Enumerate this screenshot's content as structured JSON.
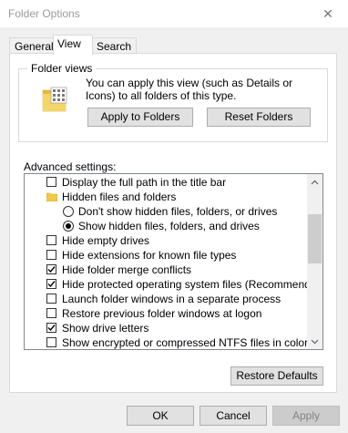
{
  "window": {
    "title": "Folder Options",
    "close_glyph": "✕"
  },
  "tabs": [
    {
      "label": "General",
      "active": false
    },
    {
      "label": "View",
      "active": true
    },
    {
      "label": "Search",
      "active": false
    }
  ],
  "folder_views": {
    "legend": "Folder views",
    "description": "You can apply this view (such as Details or Icons) to all folders of this type.",
    "icon": "folder-views-icon",
    "apply_button": "Apply to Folders",
    "reset_button": "Reset Folders"
  },
  "advanced": {
    "label": "Advanced settings:",
    "items": [
      {
        "label": "Display the full path in the title bar",
        "control": "checkbox",
        "checked": false
      },
      {
        "label": "Hidden files and folders",
        "control": "folder-icon"
      },
      {
        "label": "Don't show hidden files, folders, or drives",
        "control": "radio",
        "checked": false
      },
      {
        "label": "Show hidden files, folders, and drives",
        "control": "radio",
        "checked": true
      },
      {
        "label": "Hide empty drives",
        "control": "checkbox",
        "checked": false
      },
      {
        "label": "Hide extensions for known file types",
        "control": "checkbox",
        "checked": false
      },
      {
        "label": "Hide folder merge conflicts",
        "control": "checkbox",
        "checked": true
      },
      {
        "label": "Hide protected operating system files (Recommended)",
        "control": "checkbox",
        "checked": true
      },
      {
        "label": "Launch folder windows in a separate process",
        "control": "checkbox",
        "checked": false
      },
      {
        "label": "Restore previous folder windows at logon",
        "control": "checkbox",
        "checked": false
      },
      {
        "label": "Show drive letters",
        "control": "checkbox",
        "checked": true
      },
      {
        "label": "Show encrypted or compressed NTFS files in color",
        "control": "checkbox",
        "checked": false
      }
    ],
    "restore_button": "Restore Defaults"
  },
  "footer": {
    "ok": "OK",
    "cancel": "Cancel",
    "apply": "Apply",
    "apply_disabled": true
  },
  "colors": {
    "title_text": "#9a9a9a",
    "button_face": "#e1e1e1",
    "folder_yellow": "#f0c84a"
  }
}
